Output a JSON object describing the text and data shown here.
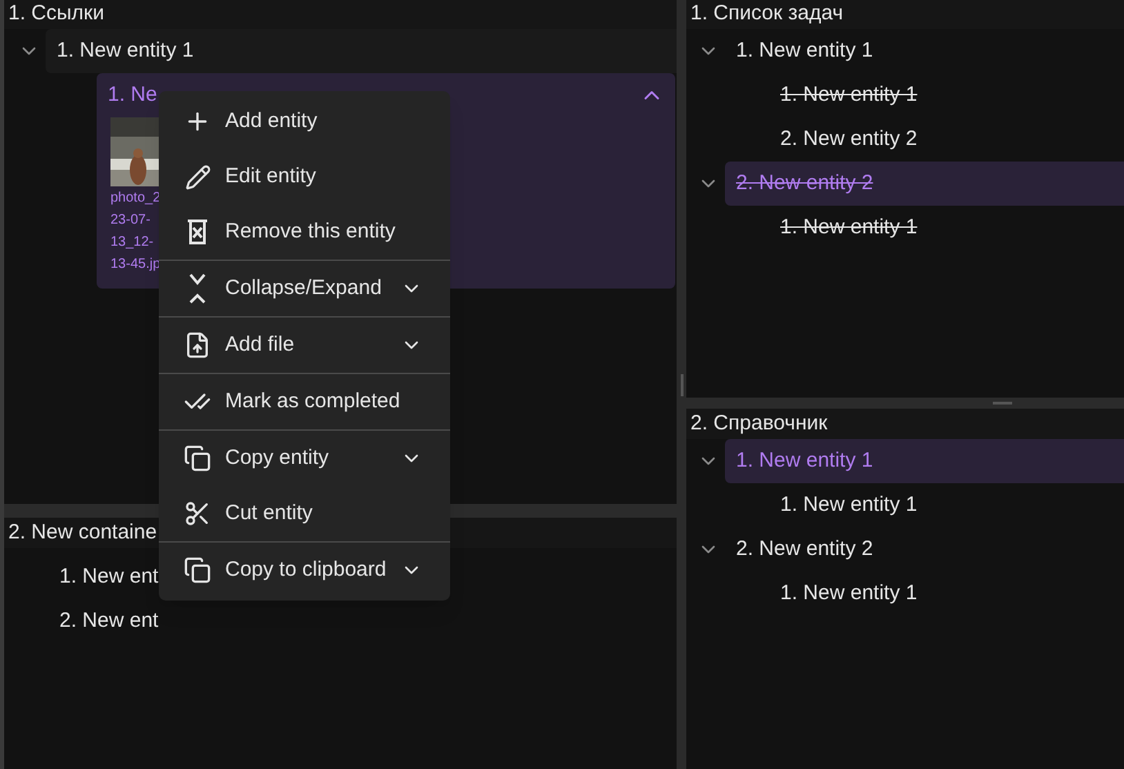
{
  "left_top": {
    "title": "1. Ссылки",
    "items": [
      {
        "label": "1. New entity 1",
        "expanded": true,
        "selected": false,
        "completed": false,
        "children": [
          {
            "kind": "card",
            "label": "1. Ne",
            "expanded": true,
            "selected": true,
            "files": [
              {
                "name_lines": [
                  "photo_2",
                  "23-07-",
                  "13_12-",
                  "13-45.jp"
                ],
                "kind": "picture"
              }
            ]
          }
        ]
      }
    ]
  },
  "left_bottom": {
    "title": "2. New containe",
    "items": [
      {
        "label": "1. New ent",
        "selected": false,
        "completed": false
      },
      {
        "label": "2. New ent",
        "selected": false,
        "completed": false
      }
    ]
  },
  "right_top": {
    "title": "1. Список задач",
    "items": [
      {
        "label": "1. New entity 1",
        "expanded": true,
        "selected": false,
        "completed": false,
        "children": [
          {
            "label": "1. New entity 1",
            "selected": false,
            "completed": true
          },
          {
            "label": "2. New entity 2",
            "selected": false,
            "completed": false
          }
        ]
      },
      {
        "label": "2. New entity 2",
        "expanded": true,
        "selected": true,
        "completed": true,
        "children": [
          {
            "label": "1. New entity 1",
            "selected": false,
            "completed": true
          }
        ]
      }
    ]
  },
  "right_bottom": {
    "title": "2. Справочник",
    "items": [
      {
        "label": "1. New entity 1",
        "expanded": true,
        "selected": true,
        "completed": false,
        "children": [
          {
            "label": "1. New entity 1",
            "selected": false,
            "completed": false
          }
        ]
      },
      {
        "label": "2. New entity 2",
        "expanded": true,
        "selected": false,
        "completed": false,
        "children": [
          {
            "label": "1. New entity 1",
            "selected": false,
            "completed": false
          }
        ]
      }
    ]
  },
  "context_menu": {
    "groups": [
      [
        {
          "label": "Add entity",
          "submenu": false
        },
        {
          "label": "Edit entity",
          "submenu": false
        },
        {
          "label": "Remove this entity",
          "submenu": false
        }
      ],
      [
        {
          "label": "Collapse/Expand",
          "submenu": true
        }
      ],
      [
        {
          "label": "Add file",
          "submenu": true
        }
      ],
      [
        {
          "label": "Mark as completed",
          "submenu": false
        }
      ],
      [
        {
          "label": "Copy entity",
          "submenu": true
        },
        {
          "label": "Cut entity",
          "submenu": false
        }
      ],
      [
        {
          "label": "Copy to clipboard",
          "submenu": true
        }
      ]
    ]
  }
}
